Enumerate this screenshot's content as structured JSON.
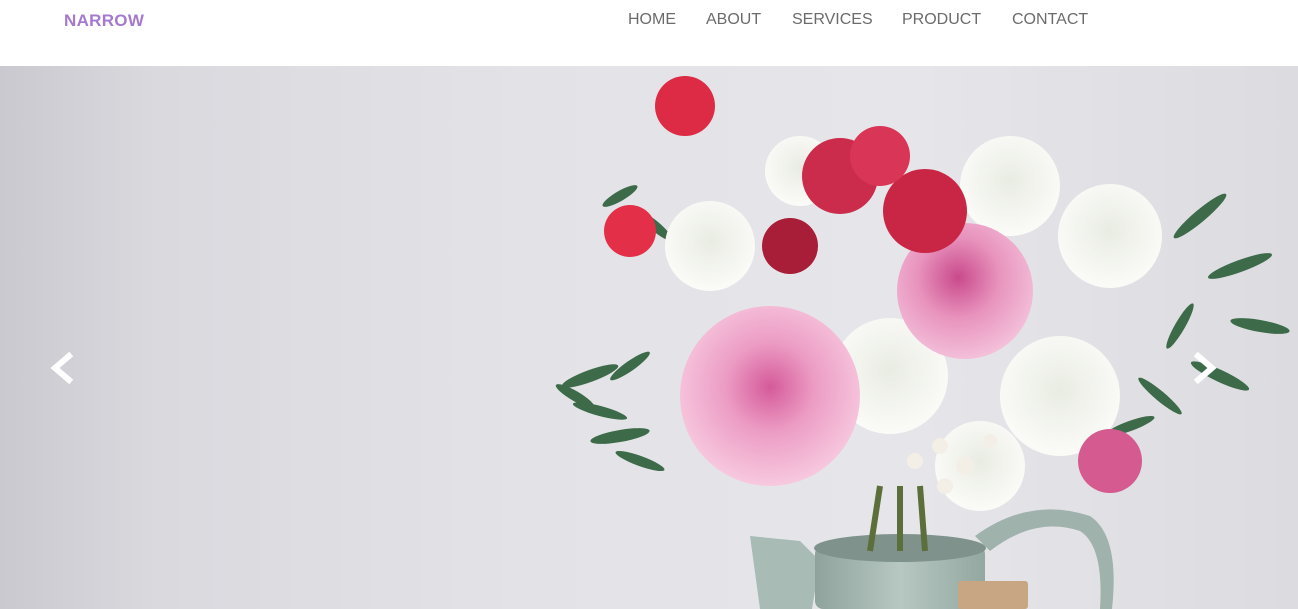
{
  "brand": {
    "name": "NARROW",
    "color": "#a479cf"
  },
  "nav": {
    "items": [
      {
        "label": "HOME"
      },
      {
        "label": "ABOUT"
      },
      {
        "label": "SERVICES"
      },
      {
        "label": "PRODUCT"
      },
      {
        "label": "CONTACT"
      }
    ],
    "text_color": "#6b6b6b"
  },
  "carousel": {
    "image_subject": "flower bouquet in pale green metal watering can",
    "prev_icon": "chevron-left-icon",
    "next_icon": "chevron-right-icon"
  }
}
